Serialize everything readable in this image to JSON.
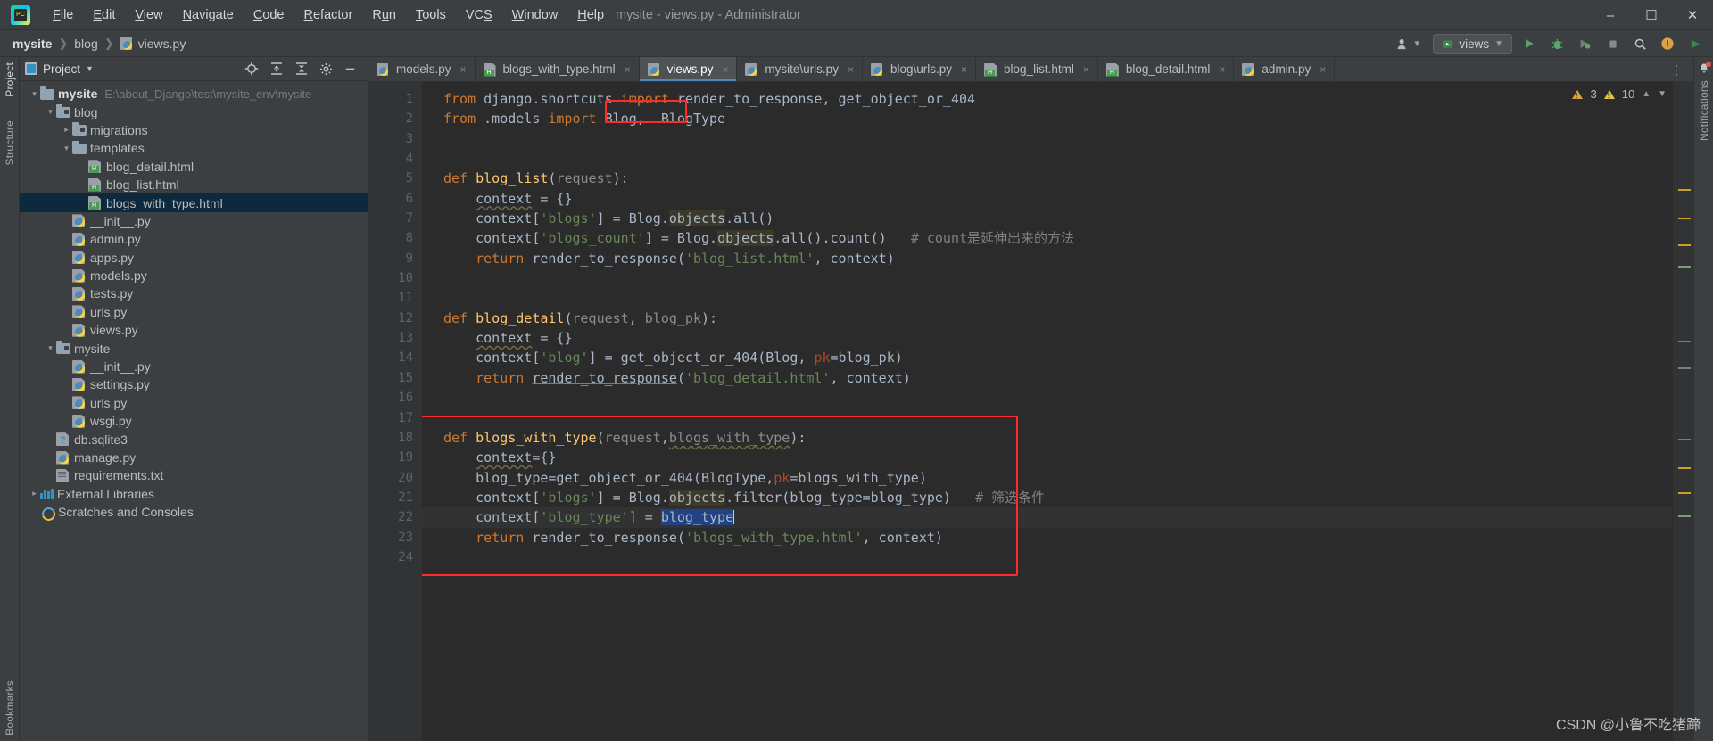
{
  "window": {
    "title": "mysite - views.py - Administrator",
    "logo_icon": "pycharm-logo-icon",
    "minimize_icon": "minimize-icon",
    "maximize_icon": "maximize-icon",
    "close_icon": "close-icon"
  },
  "menu": [
    {
      "label": "File"
    },
    {
      "label": "Edit"
    },
    {
      "label": "View"
    },
    {
      "label": "Navigate"
    },
    {
      "label": "Code"
    },
    {
      "label": "Refactor"
    },
    {
      "label": "Run"
    },
    {
      "label": "Tools"
    },
    {
      "label": "VCS"
    },
    {
      "label": "Window"
    },
    {
      "label": "Help"
    }
  ],
  "breadcrumbs": [
    {
      "label": "mysite",
      "icon": ""
    },
    {
      "label": "blog",
      "icon": ""
    },
    {
      "label": "views.py",
      "icon": "python-file-icon"
    }
  ],
  "navbar_right": {
    "user_icon": "user-icon",
    "run_config": "views",
    "run_icon": "run-icon",
    "debug_icon": "debug-icon",
    "coverage_icon": "coverage-icon",
    "stop_icon": "stop-icon",
    "search_icon": "search-icon",
    "updates_icon": "updates-icon",
    "share_icon": "share-icon"
  },
  "left_strips": {
    "project_label": "Project",
    "structure_label": "Structure",
    "bookmarks_label": "Bookmarks"
  },
  "right_strip": {
    "notifications_label": "Notifications",
    "bell_icon": "bell-icon"
  },
  "project_panel": {
    "title": "Project",
    "dropdown_icon": "chevron-down-icon",
    "tools": [
      "locate-icon",
      "expand-all-icon",
      "collapse-all-icon",
      "settings-icon",
      "hide-icon"
    ],
    "tree": [
      {
        "depth": 0,
        "arrow": "v",
        "icon": "folder",
        "label": "mysite",
        "bold": true,
        "path": "E:\\about_Django\\test\\mysite_env\\mysite",
        "selected": false
      },
      {
        "depth": 1,
        "arrow": "v",
        "icon": "folder-src",
        "label": "blog",
        "bold": false,
        "path": "",
        "selected": false
      },
      {
        "depth": 2,
        "arrow": ">",
        "icon": "folder-src",
        "label": "migrations",
        "bold": false,
        "path": "",
        "selected": false
      },
      {
        "depth": 2,
        "arrow": "v",
        "icon": "folder",
        "label": "templates",
        "bold": false,
        "path": "",
        "selected": false
      },
      {
        "depth": 3,
        "arrow": "",
        "icon": "html",
        "label": "blog_detail.html",
        "bold": false,
        "path": "",
        "selected": false
      },
      {
        "depth": 3,
        "arrow": "",
        "icon": "html",
        "label": "blog_list.html",
        "bold": false,
        "path": "",
        "selected": false
      },
      {
        "depth": 3,
        "arrow": "",
        "icon": "html",
        "label": "blogs_with_type.html",
        "bold": false,
        "path": "",
        "selected": true
      },
      {
        "depth": 2,
        "arrow": "",
        "icon": "py",
        "label": "__init__.py",
        "bold": false,
        "path": "",
        "selected": false
      },
      {
        "depth": 2,
        "arrow": "",
        "icon": "py",
        "label": "admin.py",
        "bold": false,
        "path": "",
        "selected": false
      },
      {
        "depth": 2,
        "arrow": "",
        "icon": "py",
        "label": "apps.py",
        "bold": false,
        "path": "",
        "selected": false
      },
      {
        "depth": 2,
        "arrow": "",
        "icon": "py",
        "label": "models.py",
        "bold": false,
        "path": "",
        "selected": false
      },
      {
        "depth": 2,
        "arrow": "",
        "icon": "py",
        "label": "tests.py",
        "bold": false,
        "path": "",
        "selected": false
      },
      {
        "depth": 2,
        "arrow": "",
        "icon": "py",
        "label": "urls.py",
        "bold": false,
        "path": "",
        "selected": false
      },
      {
        "depth": 2,
        "arrow": "",
        "icon": "py",
        "label": "views.py",
        "bold": false,
        "path": "",
        "selected": false
      },
      {
        "depth": 1,
        "arrow": "v",
        "icon": "folder-src",
        "label": "mysite",
        "bold": false,
        "path": "",
        "selected": false
      },
      {
        "depth": 2,
        "arrow": "",
        "icon": "py",
        "label": "__init__.py",
        "bold": false,
        "path": "",
        "selected": false
      },
      {
        "depth": 2,
        "arrow": "",
        "icon": "py",
        "label": "settings.py",
        "bold": false,
        "path": "",
        "selected": false
      },
      {
        "depth": 2,
        "arrow": "",
        "icon": "py",
        "label": "urls.py",
        "bold": false,
        "path": "",
        "selected": false
      },
      {
        "depth": 2,
        "arrow": "",
        "icon": "py",
        "label": "wsgi.py",
        "bold": false,
        "path": "",
        "selected": false
      },
      {
        "depth": 1,
        "arrow": "",
        "icon": "db",
        "label": "db.sqlite3",
        "bold": false,
        "path": "",
        "selected": false
      },
      {
        "depth": 1,
        "arrow": "",
        "icon": "py",
        "label": "manage.py",
        "bold": false,
        "path": "",
        "selected": false
      },
      {
        "depth": 1,
        "arrow": "",
        "icon": "txt",
        "label": "requirements.txt",
        "bold": false,
        "path": "",
        "selected": false
      },
      {
        "depth": 0,
        "arrow": ">",
        "icon": "lib",
        "label": "External Libraries",
        "bold": false,
        "path": "",
        "selected": false
      },
      {
        "depth": 0,
        "arrow": "",
        "icon": "scratch",
        "label": "Scratches and Consoles",
        "bold": false,
        "path": "",
        "selected": false
      }
    ]
  },
  "editor": {
    "tabs": [
      {
        "label": "models.py",
        "icon": "python-file-icon",
        "active": false,
        "close": "×"
      },
      {
        "label": "blogs_with_type.html",
        "icon": "html-file-icon",
        "active": false,
        "close": "×"
      },
      {
        "label": "views.py",
        "icon": "python-file-icon",
        "active": true,
        "close": "×"
      },
      {
        "label": "mysite\\urls.py",
        "icon": "python-file-icon",
        "active": false,
        "close": "×"
      },
      {
        "label": "blog\\urls.py",
        "icon": "python-file-icon",
        "active": false,
        "close": "×"
      },
      {
        "label": "blog_list.html",
        "icon": "html-file-icon",
        "active": false,
        "close": "×"
      },
      {
        "label": "blog_detail.html",
        "icon": "html-file-icon",
        "active": false,
        "close": "×"
      },
      {
        "label": "admin.py",
        "icon": "python-file-icon",
        "active": false,
        "close": "×"
      }
    ],
    "tab_overflow_icon": "more-options-icon",
    "inspections": {
      "error_count": "3",
      "warning_count": "10",
      "error_icon": "warning-orange-icon",
      "warning_icon": "warning-yellow-icon",
      "up_icon": "chevron-up-icon",
      "down_icon": "chevron-down-icon"
    },
    "line_numbers": [
      "1",
      "2",
      "3",
      "4",
      "5",
      "6",
      "7",
      "8",
      "9",
      "10",
      "11",
      "12",
      "13",
      "14",
      "15",
      "16",
      "17",
      "18",
      "19",
      "20",
      "21",
      "22",
      "23",
      "24"
    ],
    "current_line": 22,
    "lines": [
      "from django.shortcuts import render_to_response, get_object_or_404",
      "from .models import Blog, BlogType",
      "",
      "",
      "def blog_list(request):",
      "    context = {}",
      "    context['blogs'] = Blog.objects.all()",
      "    context['blogs_count'] = Blog.objects.all().count()   # count是延伸出来的方法",
      "    return render_to_response('blog_list.html', context)",
      "",
      "",
      "def blog_detail(request, blog_pk):",
      "    context = {}",
      "    context['blog'] = get_object_or_404(Blog, pk=blog_pk)",
      "    return render_to_response('blog_detail.html', context)",
      "",
      "",
      "def blogs_with_type(request,blogs_with_type):",
      "    context={}",
      "    blog_type=get_object_or_404(BlogType,pk=blogs_with_type)",
      "    context['blogs'] = Blog.objects.filter(blog_type=blog_type)   # 筛选条件",
      "    context['blog_type'] = blog_type",
      "    return render_to_response('blogs_with_type.html', context)",
      ""
    ],
    "annotations": {
      "highlight_box_1": "BlogType",
      "highlight_box_2": "blogs_with_type function block",
      "selected_token": "blog_type"
    }
  },
  "watermark": "CSDN @小鲁不吃猪蹄",
  "colors": {
    "accent": "#4a88c7",
    "selection": "#0d293e",
    "annotation_red": "#ff2b2b",
    "keyword": "#cc7832",
    "string": "#6a8759",
    "function": "#ffc66d",
    "comment": "#808080",
    "editor_bg": "#2b2b2b",
    "chrome_bg": "#3c3f41"
  }
}
